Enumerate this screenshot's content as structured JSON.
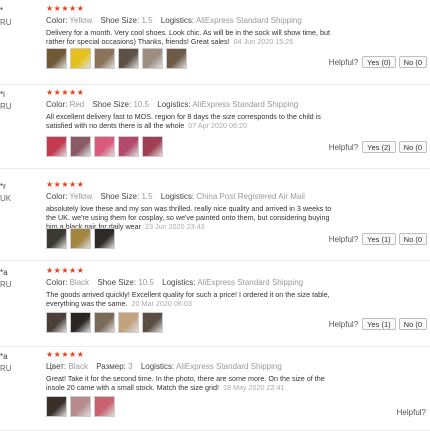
{
  "labels": {
    "color": "Color:",
    "shoe_size": "Shoe Size:",
    "logistics": "Logistics:",
    "helpful": "Helpful?",
    "stars": "★★★★★"
  },
  "reviews": [
    {
      "user": "*",
      "country": "RU",
      "color_label": "Color:",
      "color": "Yellow",
      "size_label": "Shoe Size:",
      "size": "1.5",
      "logistics": "AliExpress Standard Shipping",
      "text": "Delivery for a month. Very cool shoes. Look chic. As will be in the sock will show time, but rather for special occasions) Thanks, friends! Great sales!",
      "date": "04 Jun 2020 15:26",
      "photos": [
        "#6f5a38",
        "#e7c11b",
        "#8a7358",
        "#5d5046",
        "#9c8f80",
        "#6e5b45"
      ],
      "yes": "Yes (0)",
      "no": "No (0"
    },
    {
      "user": "*i",
      "country": "RU",
      "color_label": "Color:",
      "color": "Red",
      "size_label": "Shoe Size:",
      "size": "10.5",
      "logistics": "AliExpress Standard Shipping",
      "text": "All excellent delivery fast to MOS. region for 8 days the size corresponds to the child is satisfied with no dents there is all the whole",
      "date": "07 Apr 2020 06:20",
      "photos": [
        "#c23a4f",
        "#8a5a66",
        "#d85a7d",
        "#b34a6e",
        "#a03f52"
      ],
      "yes": "Yes (2)",
      "no": "No (0"
    },
    {
      "user": "*r",
      "country": "UK",
      "color_label": "Color:",
      "color": "Yellow",
      "size_label": "Shoe Size:",
      "size": "1.5",
      "logistics": "China Post Registered Air Mail",
      "text": "absolutely love these and my son was thrilled. really nice quality and arrived in 3 weeks to the UK. we're using them for cosplay, so we've painted onto them, but considering buying him a black pair for daily wear",
      "date": "23 Jun 2020 23:43",
      "photos": [
        "#3a3a32",
        "#a28640",
        "#2e2a26"
      ],
      "yes": "Yes (1)",
      "no": "No (0"
    },
    {
      "user": "*a",
      "country": "RU",
      "color_label": "Color:",
      "color": "Black",
      "size_label": "Shoe Size:",
      "size": "10.5",
      "logistics": "AliExpress Standard Shipping",
      "text": "The goods arrived quickly! Excellent quality for such a price! I ordered it on the size table, everything was the same.",
      "date": "20 Mar 2020 06:03",
      "photos": [
        "#4a4038",
        "#2b2623",
        "#7a6a58",
        "#c3a27e",
        "#5a4e42"
      ],
      "yes": "Yes (1)",
      "no": "No (0"
    },
    {
      "user": "*a",
      "country": "RU",
      "color_label": "Цвет:",
      "color": "Black",
      "size_label": "Размер:",
      "size": "3",
      "logistics": "AliExpress Standard Shipping",
      "text": "Great! Take it for the second time. In the photo, there are some more. On the size of the insole 20 came with a small stock. Match the size grid!",
      "date": "18 May 2020 22:41",
      "photos": [
        "#3b2f2a",
        "#b78a8c",
        "#c8626f"
      ],
      "yes": "",
      "no": ""
    }
  ]
}
